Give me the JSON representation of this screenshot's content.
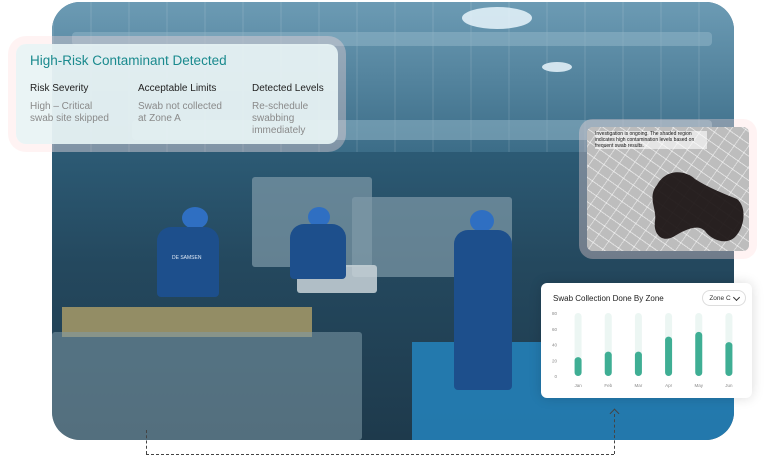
{
  "alert": {
    "title": "High-Risk Contaminant Detected",
    "columns": [
      {
        "heading": "Risk Severity",
        "value": "High – Critical swab site skipped"
      },
      {
        "heading": "Acceptable Limits",
        "value": "Swab not collected at Zone A"
      },
      {
        "heading": "Detected Levels",
        "value": "Re-schedule swabbing immediately"
      }
    ]
  },
  "map": {
    "note": "Investigation is ongoing. The shaded region indicates high contamination levels based on frequent swab results."
  },
  "worker_label": "DE SAMSEN",
  "chart_card": {
    "title": "Swab Collection Done By Zone",
    "zone_selected": "Zone C"
  },
  "chart_data": {
    "type": "bar",
    "categories": [
      "Jan",
      "Feb",
      "Mar",
      "Apr",
      "May",
      "Jun"
    ],
    "values": [
      24,
      31,
      31,
      50,
      56,
      43
    ],
    "yticks": [
      0,
      20,
      40,
      60,
      80
    ],
    "ylim": [
      0,
      80
    ],
    "bar_color": "#3fae94",
    "track_color": "#ecf6f3"
  }
}
